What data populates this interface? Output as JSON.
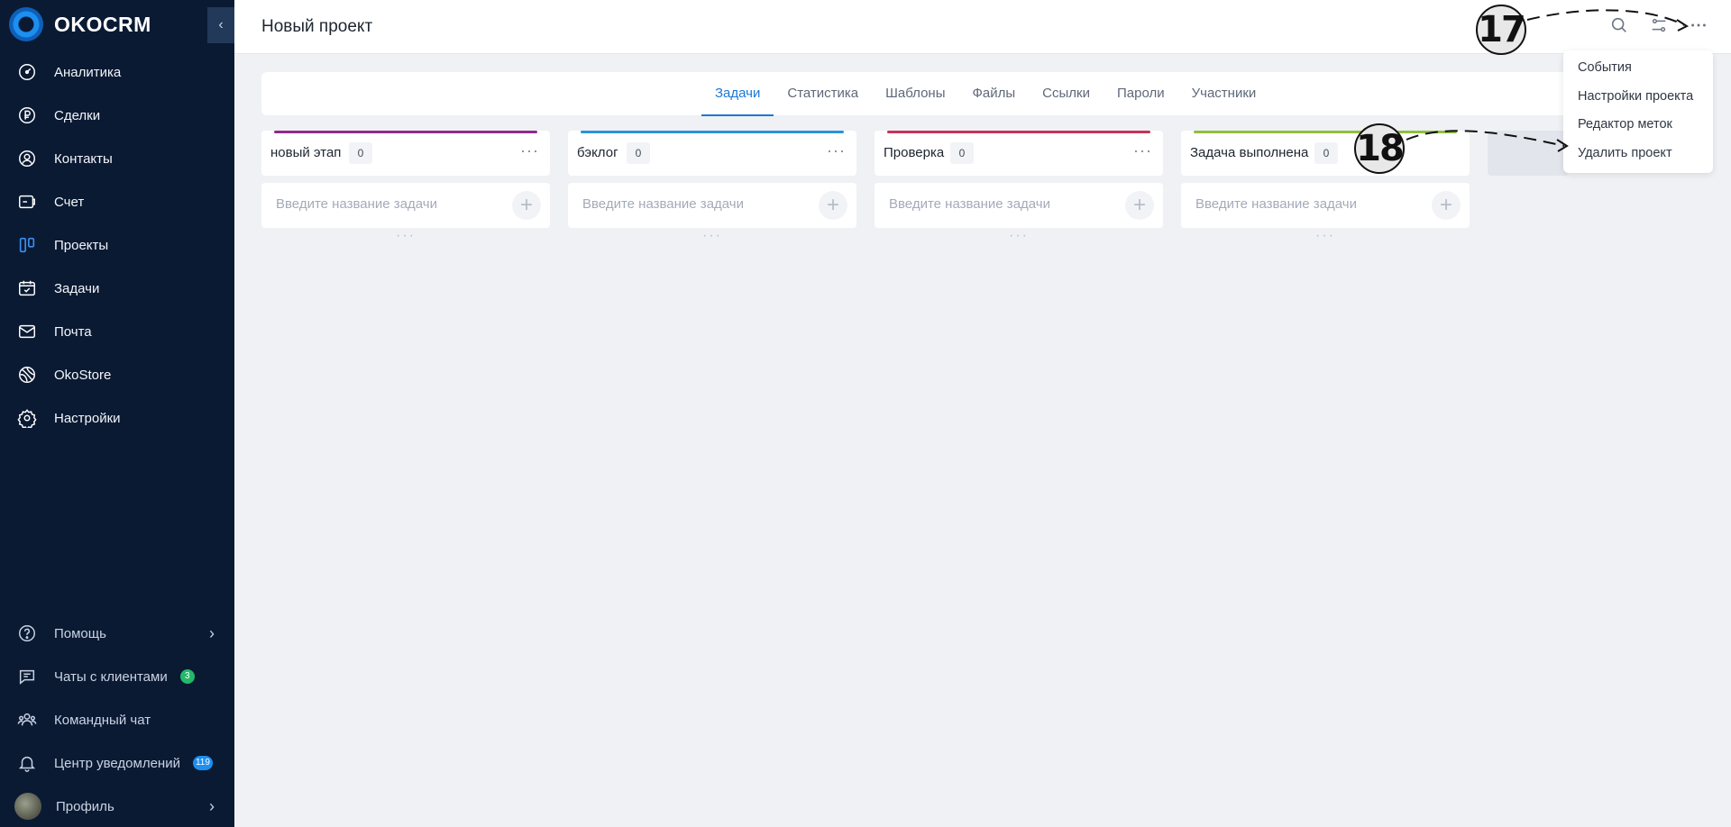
{
  "brand": {
    "name": "OKOCRM"
  },
  "sidebar": {
    "collapse_icon": "chevron-left-icon",
    "items": [
      {
        "label": "Аналитика",
        "icon": "analytics-icon"
      },
      {
        "label": "Сделки",
        "icon": "ruble-icon"
      },
      {
        "label": "Контакты",
        "icon": "user-icon"
      },
      {
        "label": "Счет",
        "icon": "invoice-icon"
      },
      {
        "label": "Проекты",
        "icon": "projects-icon"
      },
      {
        "label": "Задачи",
        "icon": "calendar-check-icon"
      },
      {
        "label": "Почта",
        "icon": "mail-icon"
      },
      {
        "label": "OkoStore",
        "icon": "store-icon"
      },
      {
        "label": "Настройки",
        "icon": "gear-icon"
      }
    ],
    "bottom": {
      "help": "Помощь",
      "client_chats": "Чаты с клиентами",
      "client_chats_badge": "3",
      "team_chat": "Командный чат",
      "notifications": "Центр уведомлений",
      "notifications_badge": "119",
      "profile": "Профиль"
    }
  },
  "header": {
    "title": "Новый проект"
  },
  "tabs": [
    "Задачи",
    "Статистика",
    "Шаблоны",
    "Файлы",
    "Ссылки",
    "Пароли",
    "Участники"
  ],
  "active_tab": "Задачи",
  "columns": [
    {
      "title": "новый этап",
      "count": "0",
      "color": "#8e2a8e"
    },
    {
      "title": "бэклог",
      "count": "0",
      "color": "#2a93d8"
    },
    {
      "title": "Проверка",
      "count": "0",
      "color": "#c8325a"
    },
    {
      "title": "Задача выполнена",
      "count": "0",
      "color": "#8fbf3f"
    }
  ],
  "task_placeholder": "Введите название задачи",
  "dropdown": {
    "items": [
      "События",
      "Настройки проекта",
      "Редактор меток",
      "Удалить проект"
    ]
  },
  "annotations": {
    "a17": "17",
    "a18": "18"
  }
}
